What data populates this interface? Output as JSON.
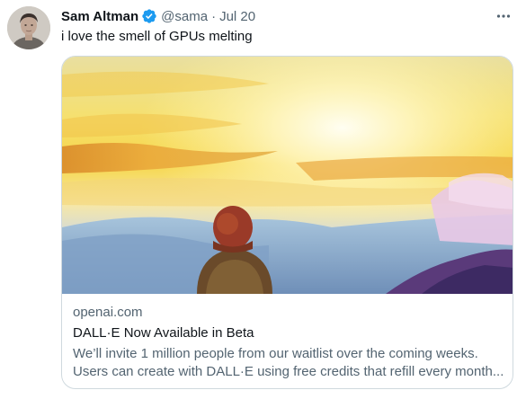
{
  "tweet": {
    "author_name": "Sam Altman",
    "handle": "@sama",
    "separator": "·",
    "time": "Jul 20",
    "text": "i love the smell of GPUs melting"
  },
  "icons": {
    "verified": "verified-badge-icon",
    "more": "more-options-icon"
  },
  "card": {
    "domain": "openai.com",
    "title": "DALL·E Now Available in Beta",
    "description_line1": "We’ll invite 1 million people from our waitlist over the coming weeks.",
    "description_line2": "Users can create with DALL·E using free credits that refill every month..."
  },
  "colors": {
    "verified_blue": "#1d9bf0",
    "secondary_text": "#536471",
    "primary_text": "#0f1419",
    "border": "#cfd9de"
  }
}
